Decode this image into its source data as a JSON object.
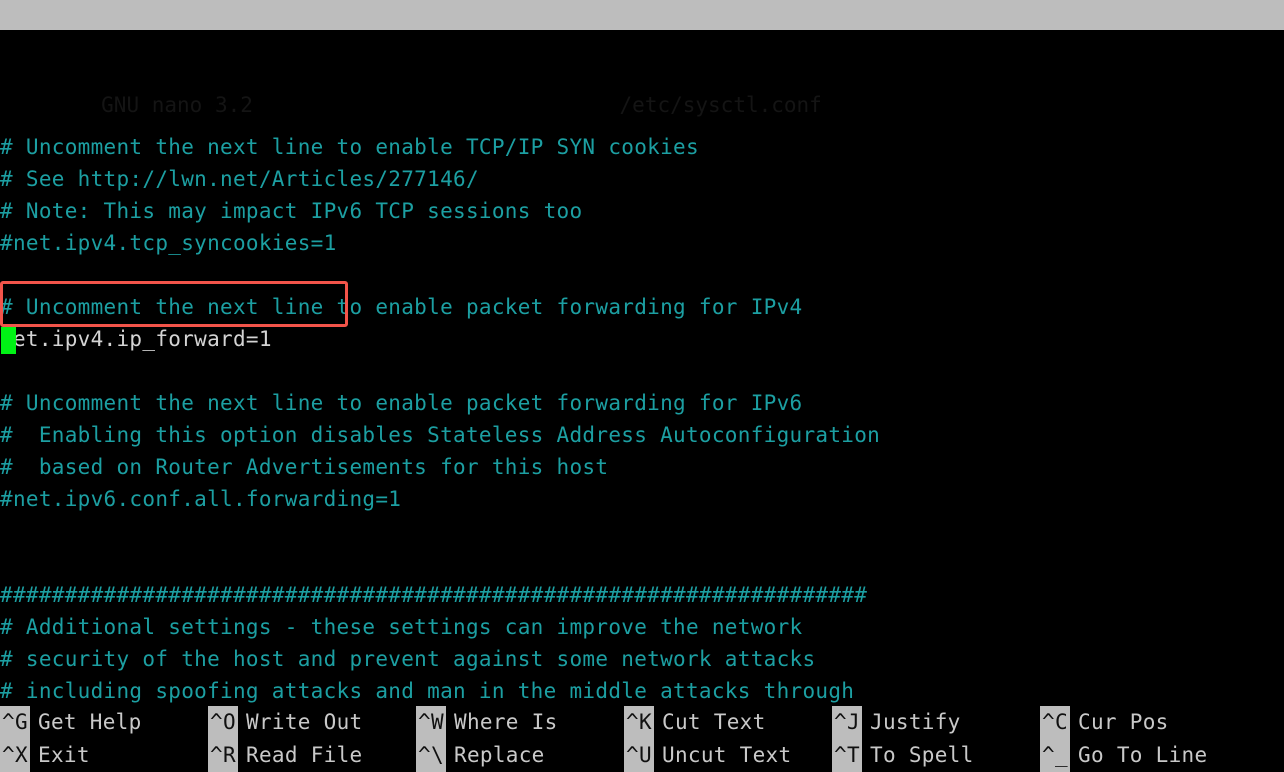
{
  "app": {
    "title": "GNU nano 3.2",
    "filename": "/etc/sysctl.conf"
  },
  "editor": {
    "lines": [
      {
        "text": "",
        "kind": "blank"
      },
      {
        "text": "",
        "kind": "blank"
      },
      {
        "text": "# Uncomment the next line to enable TCP/IP SYN cookies",
        "kind": "comment"
      },
      {
        "text": "# See http://lwn.net/Articles/277146/",
        "kind": "comment"
      },
      {
        "text": "# Note: This may impact IPv6 TCP sessions too",
        "kind": "comment"
      },
      {
        "text": "#net.ipv4.tcp_syncookies=1",
        "kind": "comment"
      },
      {
        "text": "",
        "kind": "blank"
      },
      {
        "text": "# Uncomment the next line to enable packet forwarding for IPv4",
        "kind": "comment"
      },
      {
        "text": "net.ipv4.ip_forward=1",
        "kind": "active"
      },
      {
        "text": "",
        "kind": "blank"
      },
      {
        "text": "# Uncomment the next line to enable packet forwarding for IPv6",
        "kind": "comment"
      },
      {
        "text": "#  Enabling this option disables Stateless Address Autoconfiguration",
        "kind": "comment"
      },
      {
        "text": "#  based on Router Advertisements for this host",
        "kind": "comment"
      },
      {
        "text": "#net.ipv6.conf.all.forwarding=1",
        "kind": "comment"
      },
      {
        "text": "",
        "kind": "blank"
      },
      {
        "text": "",
        "kind": "blank"
      },
      {
        "text": "###################################################################",
        "kind": "comment"
      },
      {
        "text": "# Additional settings - these settings can improve the network",
        "kind": "comment"
      },
      {
        "text": "# security of the host and prevent against some network attacks",
        "kind": "comment"
      },
      {
        "text": "# including spoofing attacks and man in the middle attacks through",
        "kind": "comment"
      }
    ]
  },
  "annotation": {
    "highlight_text": "net.ipv4.ip_forward=1",
    "box_color": "#f2544a"
  },
  "cursor": {
    "color": "#00f215"
  },
  "helpbar": {
    "columns": [
      {
        "top": {
          "key": "^G",
          "label": "Get Help"
        },
        "bottom": {
          "key": "^X",
          "label": "Exit"
        }
      },
      {
        "top": {
          "key": "^O",
          "label": "Write Out"
        },
        "bottom": {
          "key": "^R",
          "label": "Read File"
        }
      },
      {
        "top": {
          "key": "^W",
          "label": "Where Is"
        },
        "bottom": {
          "key": "^\\",
          "label": "Replace"
        }
      },
      {
        "top": {
          "key": "^K",
          "label": "Cut Text"
        },
        "bottom": {
          "key": "^U",
          "label": "Uncut Text"
        }
      },
      {
        "top": {
          "key": "^J",
          "label": "Justify"
        },
        "bottom": {
          "key": "^T",
          "label": "To Spell"
        }
      },
      {
        "top": {
          "key": "^C",
          "label": "Cur Pos"
        },
        "bottom": {
          "key": "^_",
          "label": "Go To Line"
        }
      }
    ]
  },
  "colors": {
    "background": "#000000",
    "comment_text": "#1c9fa2",
    "active_text": "#d4d4d4",
    "bar_background": "#bdbdbd",
    "bar_text": "#141414",
    "help_label_text": "#c9c9c9"
  }
}
